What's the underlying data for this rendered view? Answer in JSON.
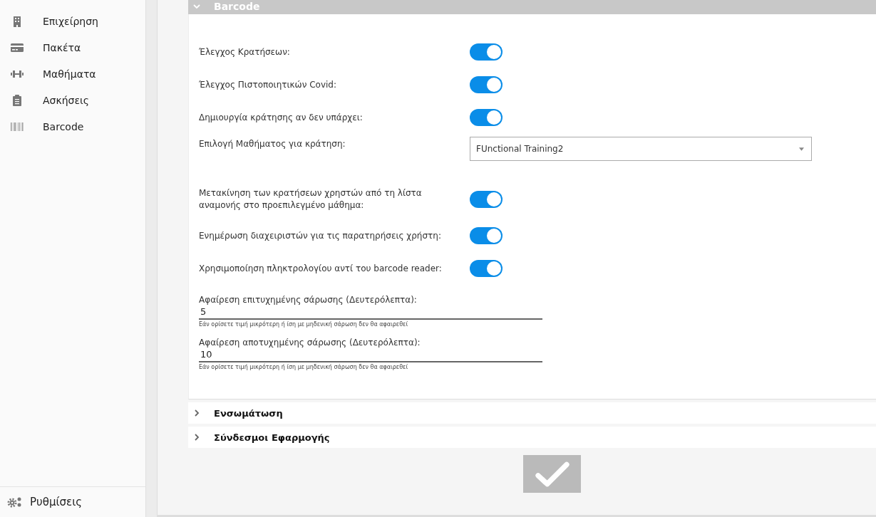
{
  "sidebar": {
    "items": [
      {
        "label": "Επιχείρηση"
      },
      {
        "label": "Πακέτα"
      },
      {
        "label": "Μαθήματα"
      },
      {
        "label": "Ασκήσεις"
      },
      {
        "label": "Barcode"
      }
    ],
    "footer": {
      "label": "Ρυθμίσεις"
    }
  },
  "sections": [
    {
      "title": "Barcode",
      "expanded": true,
      "settings": [
        {
          "kind": "toggle",
          "label": "Έλεγχος Κρατήσεων:",
          "on": true
        },
        {
          "kind": "toggle",
          "label": "Έλεγχος Πιστοποιητικών Covid:",
          "on": true
        },
        {
          "kind": "toggle",
          "label": "Δημιουργία κράτησης αν δεν υπάρχει:",
          "on": true
        },
        {
          "kind": "select",
          "label": "Επιλογή Μαθήματος για κράτηση:",
          "value": "FUnctional Training2"
        },
        {
          "kind": "toggle",
          "label": "Μετακίνηση των κρατήσεων χρηστών από τη λίστα αναμονής στο προεπιλεγμένο μάθημα:",
          "on": true
        },
        {
          "kind": "toggle",
          "label": "Ενημέρωση διαχειριστών για τις παρατηρήσεις χρήστη:",
          "on": true
        },
        {
          "kind": "toggle",
          "label": "Χρησιμοποίηση πληκτρολογίου αντί του barcode reader:",
          "on": true
        },
        {
          "kind": "number",
          "label": "Αφαίρεση επιτυχημένης σάρωσης (Δευτερόλεπτα):",
          "value": "5",
          "hint": "Εάν ορίσετε τιμή μικρότερη ή ίση με μηδενική σάρωση δεν θα αφαιρεθεί"
        },
        {
          "kind": "number",
          "label": "Αφαίρεση αποτυχημένης σάρωσης (Δευτερόλεπτα):",
          "value": "10",
          "hint": "Εάν ορίσετε τιμή μικρότερη ή ίση με μηδενική σάρωση δεν θα αφαιρεθεί"
        }
      ]
    },
    {
      "title": "Ενσωμάτωση",
      "expanded": false
    },
    {
      "title": "Σύνδεσμοι Εφαρμογής",
      "expanded": false
    }
  ]
}
